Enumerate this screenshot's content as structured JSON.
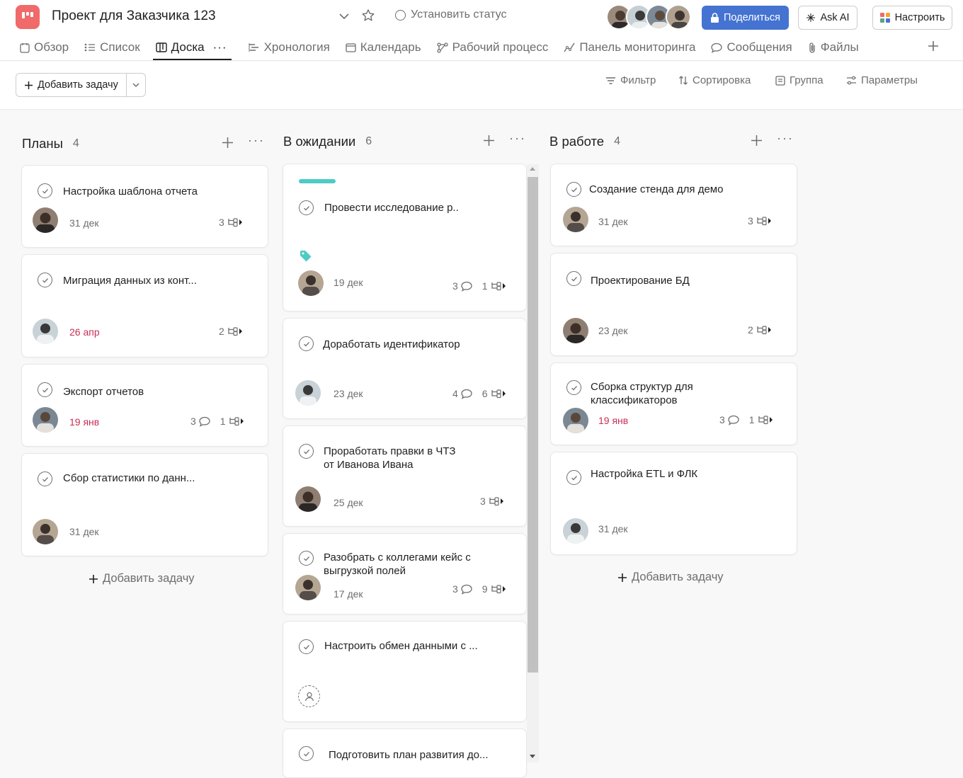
{
  "header": {
    "project_title": "Проект для Заказчика 123",
    "status_label": "Установить статус",
    "share_label": "Поделиться",
    "ask_ai_label": "Ask AI",
    "customize_label": "Настроить",
    "brand_color": "#f06a6a",
    "share_color": "#4573d2"
  },
  "tabs": [
    {
      "label": "Обзор",
      "icon": "overview-icon"
    },
    {
      "label": "Список",
      "icon": "list-icon"
    },
    {
      "label": "Доска",
      "icon": "board-icon",
      "active": true
    },
    {
      "label": "Хронология",
      "icon": "timeline-icon"
    },
    {
      "label": "Календарь",
      "icon": "calendar-icon"
    },
    {
      "label": "Рабочий процесс",
      "icon": "workflow-icon"
    },
    {
      "label": "Панель мониторинга",
      "icon": "dashboard-icon"
    },
    {
      "label": "Сообщения",
      "icon": "messages-icon"
    },
    {
      "label": "Файлы",
      "icon": "attachment-icon"
    }
  ],
  "toolbar": {
    "add_task": "Добавить задачу",
    "filter": "Фильтр",
    "sort": "Сортировка",
    "group": "Группа",
    "options": "Параметры"
  },
  "columns": [
    {
      "title": "Планы",
      "count": "4",
      "add_task": "Добавить задачу",
      "cards": [
        {
          "name": "Настройка шаблона отчета",
          "date": "31 дек",
          "subtasks": "3"
        },
        {
          "name": "Миграция данных из конт...",
          "date": "26 апр",
          "overdue": true,
          "subtasks": "2"
        },
        {
          "name": "Экспорт отчетов",
          "date": "19 янв",
          "overdue": true,
          "comments": "3",
          "subtasks": "1"
        },
        {
          "name": "Сбор статистики по данн...",
          "date": "31 дек"
        }
      ]
    },
    {
      "title": "В ожидании",
      "count": "6",
      "cards": [
        {
          "name": "Провести исследование р..",
          "date": "19 дек",
          "comments": "3",
          "subtasks": "1",
          "accent": "#4ecbc4"
        },
        {
          "name": "Доработать идентификатор",
          "date": "23 дек",
          "comments": "4",
          "subtasks": "6"
        },
        {
          "name_line1": "Проработать правки в ЧТЗ",
          "name_line2": "от Иванова Ивана",
          "date": "25 дек",
          "subtasks": "3"
        },
        {
          "name_line1": "Разобрать с коллегами кейс с",
          "name_line2": "выгрузкой полей",
          "date": "17 дек",
          "comments": "3",
          "subtasks": "9"
        },
        {
          "name": "Настроить обмен данными с ..."
        },
        {
          "name": "Подготовить план развития до..."
        }
      ]
    },
    {
      "title": "В работе",
      "count": "4",
      "add_task": "Добавить задачу",
      "cards": [
        {
          "name": "Создание стенда для демо",
          "date": "31 дек",
          "subtasks": "3"
        },
        {
          "name": "Проектирование БД",
          "date": "23 дек",
          "subtasks": "2"
        },
        {
          "name_line1": "Сборка структур для",
          "name_line2": "классификаторов",
          "date": "19 янв",
          "overdue": true,
          "comments": "3",
          "subtasks": "1"
        },
        {
          "name": "Настройка ETL и ФЛК",
          "date": "31 дек"
        }
      ]
    }
  ]
}
